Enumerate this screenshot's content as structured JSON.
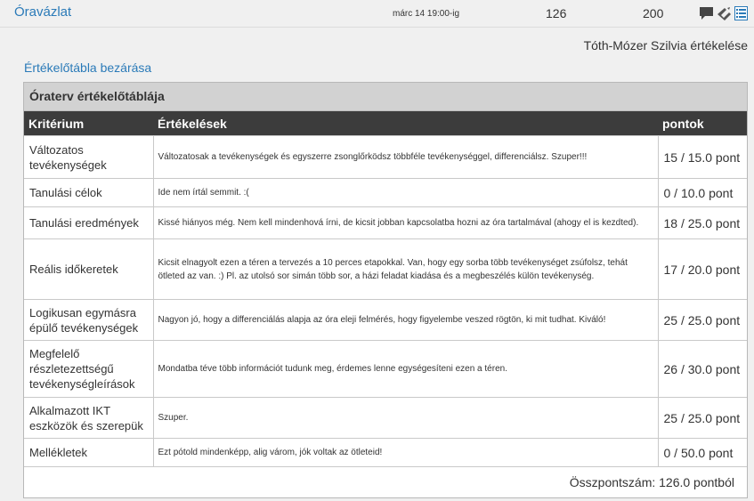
{
  "header": {
    "title": "Óravázlat",
    "due": "márc 14 19:00-ig",
    "score": "126",
    "possible": "200"
  },
  "grader_label": "Tóth-Mózer Szilvia értékelése",
  "close_link": "Értékelőtábla bezárása",
  "rubric": {
    "title": "Óraterv értékelőtáblája",
    "columns": {
      "criterion": "Kritérium",
      "comments": "Értékelések",
      "points": "pontok"
    },
    "rows": [
      {
        "criterion": "Változatos tevékenységek",
        "comment": "Változatosak a tevékenységek és egyszerre zsonglőrködsz többféle tevékenységgel, differenciálsz. Szuper!!!",
        "points": "15 / 15.0 pont"
      },
      {
        "criterion": "Tanulási célok",
        "comment": "Ide nem írtál semmit. :(",
        "points": "0 / 10.0 pont"
      },
      {
        "criterion": "Tanulási eredmények",
        "comment": "Kissé hiányos még. Nem kell mindenhová írni, de kicsit jobban kapcsolatba hozni az óra tartalmával (ahogy el is kezdted).",
        "points": "18 / 25.0 pont"
      },
      {
        "criterion": "Reális időkeretek",
        "comment": "Kicsit elnagyolt ezen a téren a tervezés a 10 perces etapokkal. Van, hogy egy sorba több tevékenységet zsúfolsz, tehát ötleted az van. :) Pl. az utolsó sor simán több sor, a házi feladat kiadása és a megbeszélés külön tevékenység.",
        "points": "17 / 20.0 pont"
      },
      {
        "criterion": "Logikusan egymásra épülő tevékenységek",
        "comment": "Nagyon jó, hogy a differenciálás alapja az óra eleji felmérés, hogy figyelembe veszed rögtön, ki mit tudhat. Kiváló!",
        "points": "25 / 25.0 pont"
      },
      {
        "criterion": "Megfelelő részletezettségű tevékenységleírások",
        "comment": "Mondatba téve több információt tudunk meg, érdemes lenne egységesíteni ezen a téren.",
        "points": "26 / 30.0 pont"
      },
      {
        "criterion": "Alkalmazott IKT eszközök és szerepük",
        "comment": "Szuper.",
        "points": "25 / 25.0 pont"
      },
      {
        "criterion": "Mellékletek",
        "comment": "Ezt pótold mindenképp, alig várom, jók voltak az ötleteid!",
        "points": "0 / 50.0 pont"
      }
    ],
    "total": "Összpontszám: 126.0 pontból"
  },
  "icons": [
    "comment-icon",
    "muted-icon",
    "rubric-icon"
  ],
  "colors": {
    "link": "#2a7ab8",
    "table_header": "#3c3c3c",
    "rubric_title_bg": "#d2d2d2"
  }
}
